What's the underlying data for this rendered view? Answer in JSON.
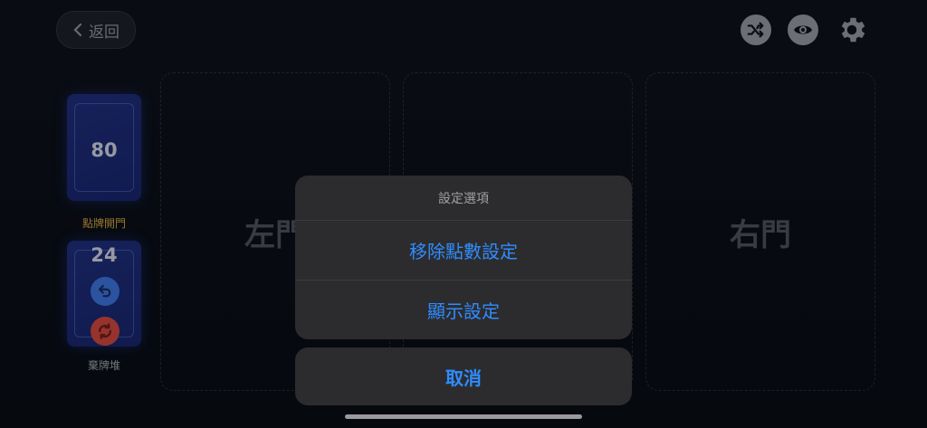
{
  "header": {
    "back_label": "返回",
    "icons": [
      "shuffle-icon",
      "eye-icon",
      "gear-icon"
    ]
  },
  "slots": {
    "left_label": "左門",
    "center_label": "",
    "right_label": "右門"
  },
  "decks": {
    "draw": {
      "count": "80",
      "label": "點牌開門",
      "label_color": "#c8a040"
    },
    "discard": {
      "count": "24",
      "label": "棄牌堆",
      "label_color": "#9a9ea6"
    }
  },
  "action_sheet": {
    "title": "設定選項",
    "actions": [
      "移除點數設定",
      "顯示設定"
    ],
    "cancel_label": "取消",
    "accent_color": "#2f8cff"
  }
}
